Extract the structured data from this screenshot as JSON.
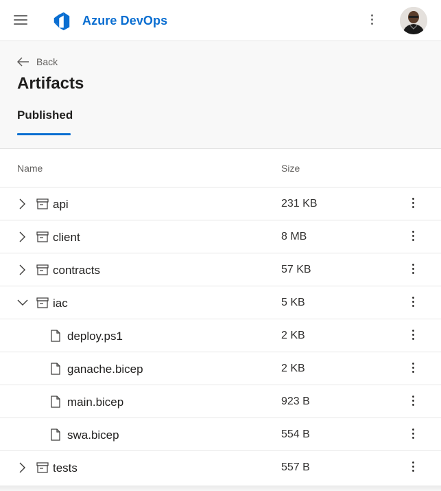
{
  "topbar": {
    "brand": "Azure DevOps",
    "icons": {
      "menu": "hamburger-menu-icon",
      "logo": "azure-devops-logo",
      "more": "more-vertical-icon",
      "avatar": "user-avatar"
    },
    "colors": {
      "brand": "#0a6ed1"
    }
  },
  "header": {
    "back_label": "Back",
    "title": "Artifacts",
    "tab": "Published"
  },
  "table": {
    "columns": {
      "name": "Name",
      "size": "Size"
    },
    "rows": [
      {
        "name": "api",
        "size": "231 KB",
        "kind": "folder",
        "expanded": false
      },
      {
        "name": "client",
        "size": "8 MB",
        "kind": "folder",
        "expanded": false
      },
      {
        "name": "contracts",
        "size": "57 KB",
        "kind": "folder",
        "expanded": false
      },
      {
        "name": "iac",
        "size": "5 KB",
        "kind": "folder",
        "expanded": true
      },
      {
        "name": "deploy.ps1",
        "size": "2 KB",
        "kind": "file"
      },
      {
        "name": "ganache.bicep",
        "size": "2 KB",
        "kind": "file"
      },
      {
        "name": "main.bicep",
        "size": "923 B",
        "kind": "file"
      },
      {
        "name": "swa.bicep",
        "size": "554 B",
        "kind": "file"
      },
      {
        "name": "tests",
        "size": "557 B",
        "kind": "folder",
        "expanded": false
      }
    ]
  }
}
